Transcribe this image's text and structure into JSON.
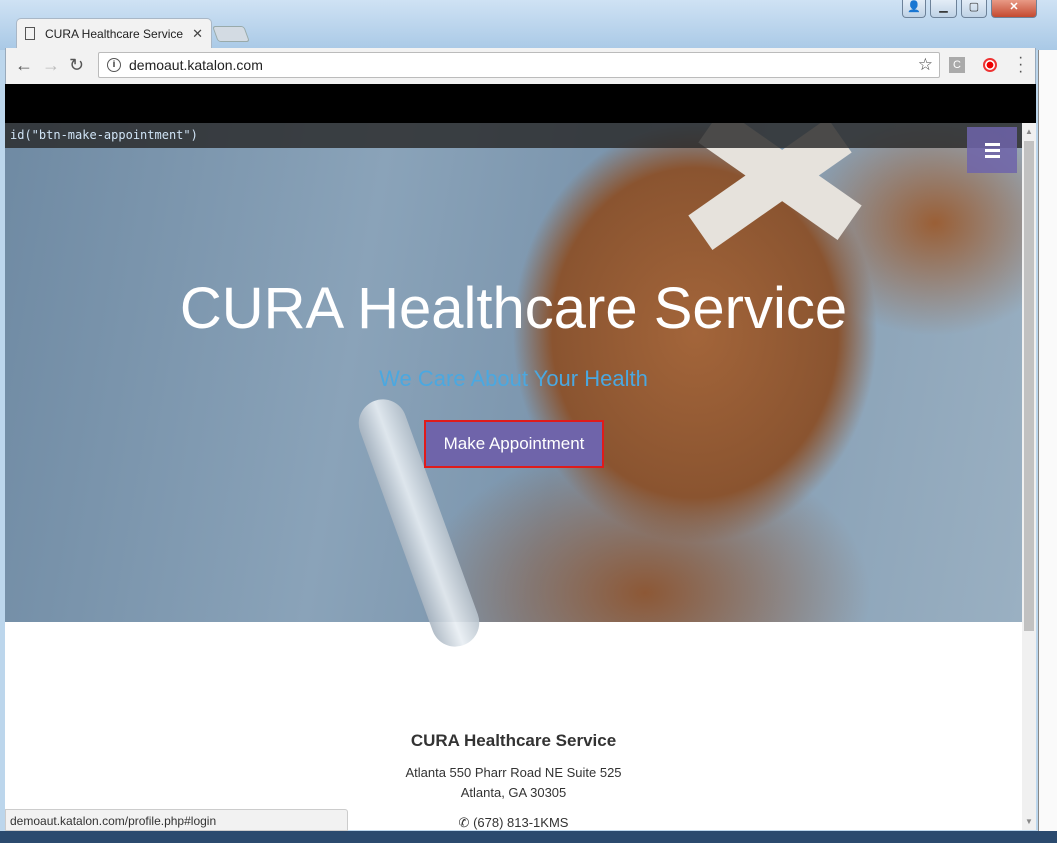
{
  "browser": {
    "tab_title": "CURA Healthcare Service",
    "url": "demoaut.katalon.com",
    "status_url": "demoaut.katalon.com/profile.php#login",
    "extension_label": "C"
  },
  "inspector": {
    "xpath": "id(\"btn-make-appointment\")"
  },
  "hero": {
    "title": "CURA Healthcare Service",
    "subtitle": "We Care About Your Health",
    "cta_label": "Make Appointment"
  },
  "footer": {
    "name": "CURA Healthcare Service",
    "address_line1": "Atlanta 550 Pharr Road NE Suite 525",
    "address_line2": "Atlanta, GA 30305",
    "phone": "(678) 813-1KMS"
  },
  "colors": {
    "accent": "#6f64aa",
    "subtitle": "#4ba8e0",
    "highlight_border": "#e01b1b"
  }
}
